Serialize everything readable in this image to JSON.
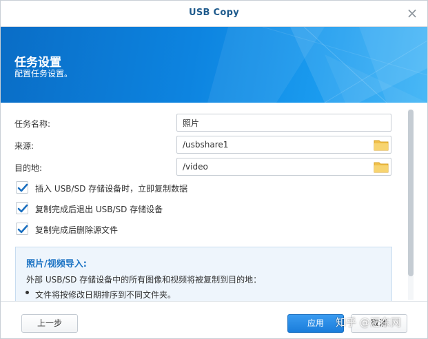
{
  "window": {
    "title": "USB Copy",
    "close_glyph": "×"
  },
  "banner": {
    "heading": "任务设置",
    "subheading": "配置任务设置。"
  },
  "form": {
    "task_name_label": "任务名称:",
    "task_name_value": "照片",
    "source_label": "来源:",
    "source_value": "/usbshare1",
    "destination_label": "目的地:",
    "destination_value": "/video",
    "folder_icon": "folder-icon"
  },
  "options": [
    {
      "label": "插入 USB/SD 存储设备时，立即复制数据",
      "checked": true
    },
    {
      "label": "复制完成后退出 USB/SD 存储设备",
      "checked": true
    },
    {
      "label": "复制完成后删除源文件",
      "checked": true
    }
  ],
  "info": {
    "title": "照片/视频导入:",
    "description": "外部 USB/SD 存储设备中的所有图像和视频将被复制到目的地：",
    "bullet": "文件将按修改日期排序到不同文件夹。"
  },
  "footer": {
    "back_label": "上一步",
    "apply_label": "应用",
    "cancel_label": "取消"
  },
  "watermark": "知乎 @汇东网",
  "colors": {
    "accent": "#1a7ddb",
    "banner": "#0d84e0",
    "title": "#1e5a8c",
    "check": "#1a6fc0"
  }
}
